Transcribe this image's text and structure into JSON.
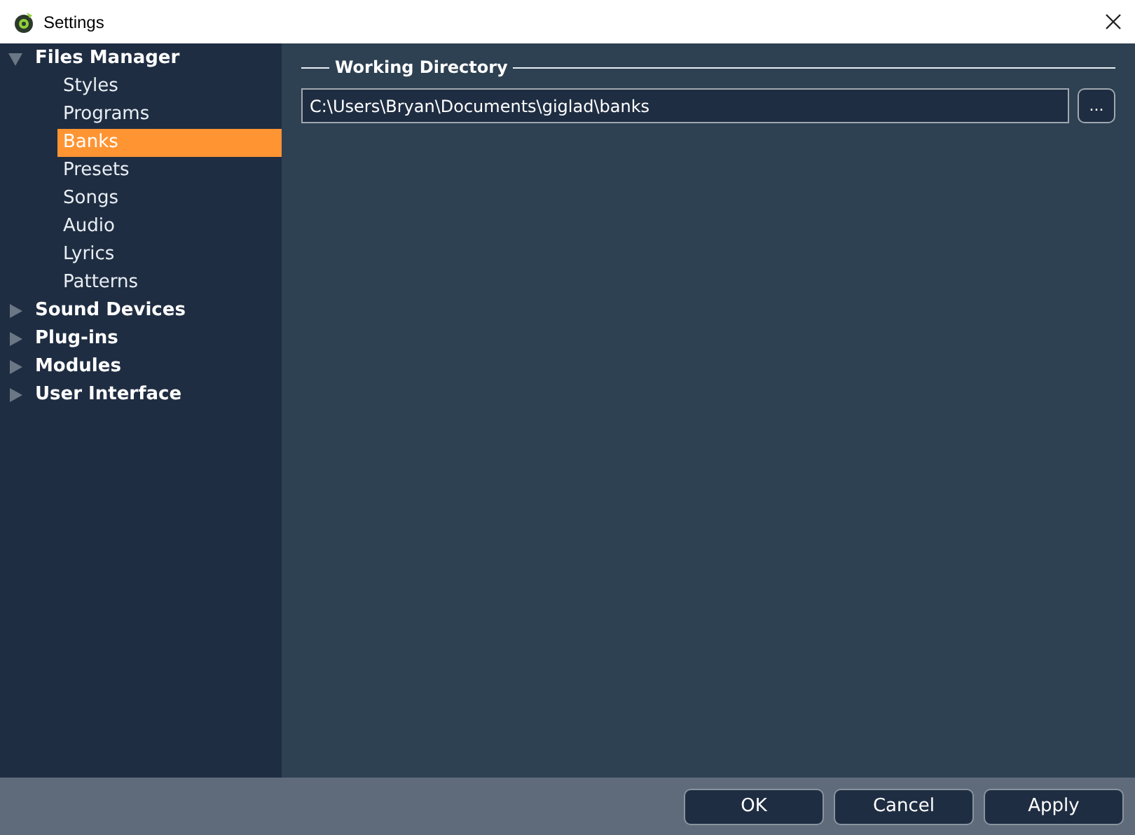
{
  "window": {
    "title": "Settings"
  },
  "sidebar": {
    "items": [
      {
        "label": "Files Manager",
        "expanded": true,
        "selected": false,
        "children": [
          {
            "label": "Styles",
            "selected": false
          },
          {
            "label": "Programs",
            "selected": false
          },
          {
            "label": "Banks",
            "selected": true
          },
          {
            "label": "Presets",
            "selected": false
          },
          {
            "label": "Songs",
            "selected": false
          },
          {
            "label": "Audio",
            "selected": false
          },
          {
            "label": "Lyrics",
            "selected": false
          },
          {
            "label": "Patterns",
            "selected": false
          }
        ]
      },
      {
        "label": "Sound Devices",
        "expanded": false,
        "selected": false
      },
      {
        "label": "Plug-ins",
        "expanded": false,
        "selected": false
      },
      {
        "label": "Modules",
        "expanded": false,
        "selected": false
      },
      {
        "label": "User Interface",
        "expanded": false,
        "selected": false
      }
    ]
  },
  "working_directory": {
    "title": "Working Directory",
    "value": "C:\\Users\\Bryan\\Documents\\giglad\\banks",
    "browse_button": "..."
  },
  "buttons": [
    "OK",
    "Cancel",
    "Apply"
  ]
}
